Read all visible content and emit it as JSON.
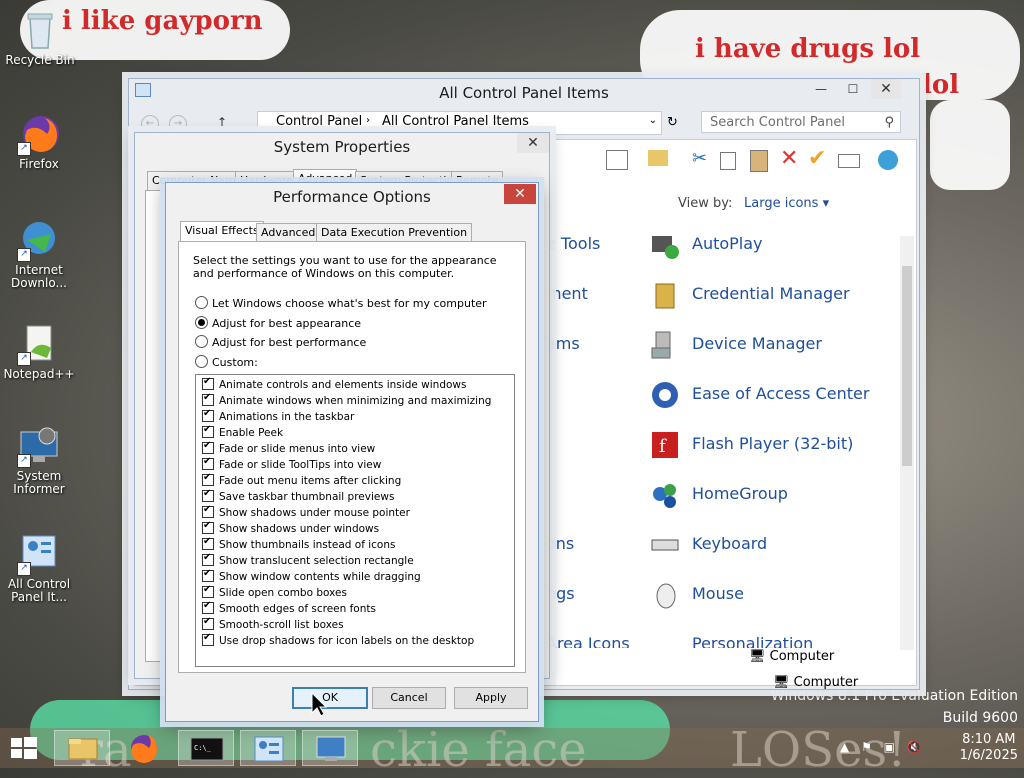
{
  "desktop": {
    "graffiti": [
      "i like gayporn",
      "i have drugs lol",
      "lol"
    ],
    "bottom_text_left": "ra",
    "bottom_text_mid": "ckie face",
    "bottom_text_right": "LOSes!",
    "edition_line": "Windows 8.1 Pro Evaluation Edition",
    "edition_visible": "Windows 8.1 Pro Evaluation Edition",
    "build": "Build 9600",
    "icons": [
      {
        "label": "Recycle Bin"
      },
      {
        "label": "Firefox"
      },
      {
        "label": "Internet Downlo..."
      },
      {
        "label": "Notepad++"
      },
      {
        "label": "System Informer"
      },
      {
        "label": "All Control Panel It..."
      }
    ]
  },
  "control_panel": {
    "title": "All Control Panel Items",
    "breadcrumb": [
      "Control Panel",
      "All Control Panel Items"
    ],
    "search_placeholder": "Search Control Panel",
    "view_by_label": "View by:",
    "view_by_value": "Large icons",
    "items": [
      "AutoPlay",
      "Credential Manager",
      "Device Manager",
      "Ease of Access Center",
      "Flash Player (32-bit)",
      "HomeGroup",
      "Keyboard",
      "Mouse",
      "Personalization"
    ],
    "left_fragments": [
      "e Tools",
      "ment",
      "ams",
      "ons",
      "ngs",
      "Area Icons"
    ],
    "status1": "Computer",
    "status2": "Computer"
  },
  "system_properties": {
    "title": "System Properties",
    "tabs": [
      "Computer Name",
      "Hardware",
      "Advanced",
      "System Protection",
      "Remote"
    ]
  },
  "performance_options": {
    "title": "Performance Options",
    "tabs": [
      "Visual Effects",
      "Advanced",
      "Data Execution Prevention"
    ],
    "description": "Select the settings you want to use for the appearance and performance of Windows on this computer.",
    "radios": [
      {
        "label": "Let Windows choose what's best for my computer",
        "selected": false
      },
      {
        "label": "Adjust for best appearance",
        "selected": true
      },
      {
        "label": "Adjust for best performance",
        "selected": false
      },
      {
        "label": "Custom:",
        "selected": false
      }
    ],
    "effects": [
      "Animate controls and elements inside windows",
      "Animate windows when minimizing and maximizing",
      "Animations in the taskbar",
      "Enable Peek",
      "Fade or slide menus into view",
      "Fade or slide ToolTips into view",
      "Fade out menu items after clicking",
      "Save taskbar thumbnail previews",
      "Show shadows under mouse pointer",
      "Show shadows under windows",
      "Show thumbnails instead of icons",
      "Show translucent selection rectangle",
      "Show window contents while dragging",
      "Slide open combo boxes",
      "Smooth edges of screen fonts",
      "Smooth-scroll list boxes",
      "Use drop shadows for icon labels on the desktop"
    ],
    "buttons": {
      "ok": "OK",
      "cancel": "Cancel",
      "apply": "Apply"
    }
  },
  "taskbar": {
    "time": "8:10 AM",
    "date": "1/6/2025"
  }
}
